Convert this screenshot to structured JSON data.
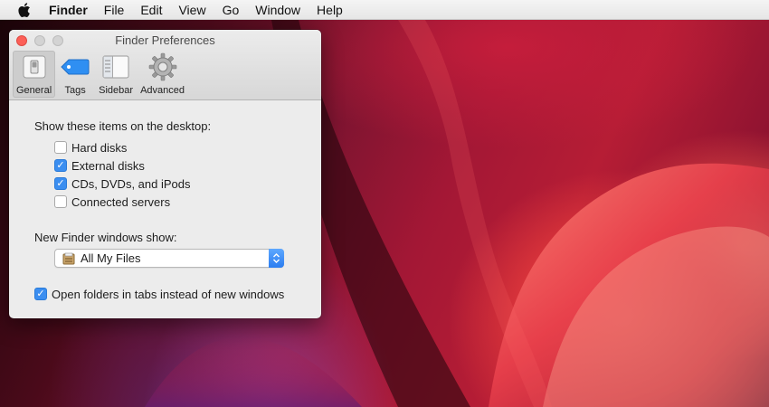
{
  "menubar": {
    "apple_icon": "apple-logo-icon",
    "app_name": "Finder",
    "items": [
      "File",
      "Edit",
      "View",
      "Go",
      "Window",
      "Help"
    ]
  },
  "window": {
    "title": "Finder Preferences",
    "tabs": [
      {
        "label": "General",
        "icon": "general-switch-icon",
        "active": true
      },
      {
        "label": "Tags",
        "icon": "tag-icon",
        "active": false
      },
      {
        "label": "Sidebar",
        "icon": "sidebar-icon",
        "active": false
      },
      {
        "label": "Advanced",
        "icon": "gear-icon",
        "active": false
      }
    ],
    "desktop_section": {
      "label": "Show these items on the desktop:",
      "items": [
        {
          "label": "Hard disks",
          "checked": false
        },
        {
          "label": "External disks",
          "checked": true
        },
        {
          "label": "CDs, DVDs, and iPods",
          "checked": true
        },
        {
          "label": "Connected servers",
          "checked": false
        }
      ]
    },
    "new_window_section": {
      "label": "New Finder windows show:",
      "selected_value": "All My Files",
      "icon": "all-my-files-icon"
    },
    "tabs_option": {
      "label": "Open folders in tabs instead of new windows",
      "checked": true
    }
  },
  "colors": {
    "accent": "#3b8ef0",
    "close_button": "#fc5f57"
  }
}
